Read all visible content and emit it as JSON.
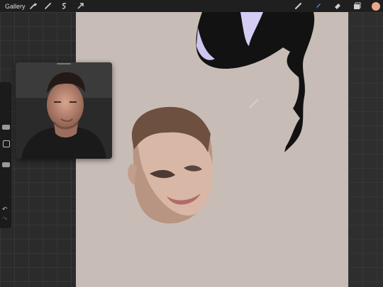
{
  "toolbar": {
    "gallery_label": "Gallery",
    "left_tools": [
      "wrench-icon",
      "magic-wand-icon",
      "selection-icon",
      "transform-arrow-icon"
    ],
    "right_tools": [
      "brush-icon",
      "smudge-icon",
      "eraser-icon",
      "layers-icon",
      "color-swatch"
    ],
    "active_tool": "smudge-icon",
    "accent_color": "#3a8ef6",
    "current_color": "#e8a98d"
  },
  "sidebar": {
    "items": [
      "brush-size-slider",
      "modify-button",
      "opacity-slider",
      "undo-button",
      "redo-button"
    ]
  },
  "canvas": {
    "background_color": "#c8bdb6"
  },
  "reference": {
    "content": "reference-photo"
  }
}
